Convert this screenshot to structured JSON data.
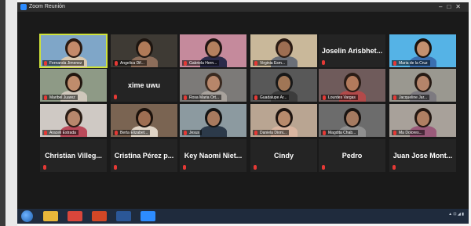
{
  "window": {
    "title": "Zoom Reunión"
  },
  "participants": [
    {
      "name": "Fernanda Jimenez",
      "kind": "video",
      "active": true,
      "bg": "#7fa6c8",
      "skin": "#c48a6a",
      "hair": "#2a1a12",
      "shirt": "#d9c8b0"
    },
    {
      "name": "Angelica Dif...",
      "kind": "video",
      "bg": "#3e3a34",
      "skin": "#b07a58",
      "hair": "#1d1510",
      "shirt": "#8c6d5a"
    },
    {
      "name": "Gabriela Hern...",
      "kind": "video",
      "bg": "#c58a9c",
      "skin": "#b3805e",
      "hair": "#201512",
      "shirt": "#2b2b4a"
    },
    {
      "name": "Virginia Esm...",
      "kind": "video",
      "bg": "#c9b89a",
      "skin": "#9d6e52",
      "hair": "#2a1b13",
      "shirt": "#6a6f78"
    },
    {
      "name": "Joselin Arisbhet...",
      "kind": "name"
    },
    {
      "name": "Maria de la Cruz",
      "kind": "video",
      "bg": "#55b3e6",
      "skin": "#c4906f",
      "hair": "#1b120d",
      "shirt": "#3a6fb0"
    },
    {
      "name": "Maribel Juarez",
      "kind": "video",
      "bg": "#8e9a86",
      "skin": "#bf8c6c",
      "hair": "#22160f",
      "shirt": "#cfc7bb"
    },
    {
      "name": "xime uwu",
      "kind": "name"
    },
    {
      "name": "Rosa Maria Ort...",
      "kind": "video",
      "bg": "#7c7a78",
      "skin": "#b7866a",
      "hair": "#3a2a20",
      "shirt": "#a8a29c"
    },
    {
      "name": "Guadalupe Ar...",
      "kind": "video",
      "bg": "#585858",
      "skin": "#a07656",
      "hair": "#181818",
      "shirt": "#3c3c3c"
    },
    {
      "name": "Lourdes Vargas",
      "kind": "video",
      "bg": "#6f5b5b",
      "skin": "#b27a5c",
      "hair": "#2a1c16",
      "shirt": "#b24a4a"
    },
    {
      "name": "Jacqueline Jar...",
      "kind": "video",
      "bg": "#9a9890",
      "skin": "#b5846a",
      "hair": "#261a14",
      "shirt": "#7d7a80"
    },
    {
      "name": "Araceli Estrada",
      "kind": "video",
      "bg": "#cfc9c4",
      "skin": "#b8876c",
      "hair": "#2b1d15",
      "shirt": "#ba4a5a"
    },
    {
      "name": "Berta Elizabet...",
      "kind": "video",
      "bg": "#7a6452",
      "skin": "#9e6e52",
      "hair": "#1c120c",
      "shirt": "#e0d4c6"
    },
    {
      "name": "Jesus",
      "kind": "video",
      "bg": "#8c9aa0",
      "skin": "#a87a5e",
      "hair": "#141414",
      "shirt": "#2c3a4a"
    },
    {
      "name": "Daniela Dioni...",
      "kind": "video",
      "bg": "#b9a592",
      "skin": "#b88a6c",
      "hair": "#1e1410",
      "shirt": "#d9b5a0"
    },
    {
      "name": "Magdita Chab...",
      "kind": "video",
      "bg": "#6c6c6c",
      "skin": "#a57a60",
      "hair": "#1a1411",
      "shirt": "#8f8f8f"
    },
    {
      "name": "Ma Dolores...",
      "kind": "video",
      "bg": "#a8a19a",
      "skin": "#b07f62",
      "hair": "#231711",
      "shirt": "#9a5a7a"
    },
    {
      "name": "Christian Villeg...",
      "kind": "name"
    },
    {
      "name": "Cristina Pérez p...",
      "kind": "name"
    },
    {
      "name": "Key Naomi Niet...",
      "kind": "name"
    },
    {
      "name": "Cindy",
      "kind": "name"
    },
    {
      "name": "Pedro",
      "kind": "name"
    },
    {
      "name": "Juan Jose Mont...",
      "kind": "name"
    }
  ],
  "taskbar": {
    "icons": [
      {
        "name": "folder-icon",
        "color": "#e8b73a"
      },
      {
        "name": "chrome-icon",
        "color": "#d9463b"
      },
      {
        "name": "powerpoint-icon",
        "color": "#d24726"
      },
      {
        "name": "word-icon",
        "color": "#2b5797"
      },
      {
        "name": "zoom-icon",
        "color": "#2d8cff"
      }
    ]
  }
}
